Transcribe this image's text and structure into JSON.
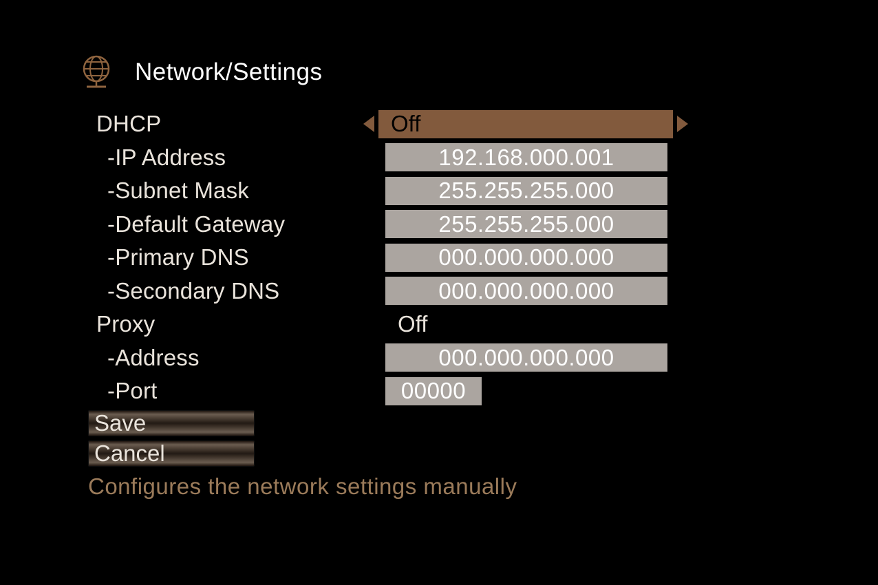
{
  "header": {
    "title": "Network/Settings",
    "icon_name": "globe-icon",
    "icon_color": "#8f643f"
  },
  "fields": {
    "dhcp": {
      "label": "DHCP",
      "value": "Off"
    },
    "ip_address": {
      "label": "-IP Address",
      "value": "192.168.000.001"
    },
    "subnet_mask": {
      "label": "-Subnet Mask",
      "value": "255.255.255.000"
    },
    "default_gateway": {
      "label": "-Default Gateway",
      "value": "255.255.255.000"
    },
    "primary_dns": {
      "label": "-Primary DNS",
      "value": "000.000.000.000"
    },
    "secondary_dns": {
      "label": "-Secondary DNS",
      "value": "000.000.000.000"
    },
    "proxy": {
      "label": "Proxy",
      "value": "Off"
    },
    "proxy_address": {
      "label": "-Address",
      "value": "000.000.000.000"
    },
    "proxy_port": {
      "label": "-Port",
      "value": "00000"
    }
  },
  "buttons": {
    "save": "Save",
    "cancel": "Cancel"
  },
  "hint": "Configures the network settings manually"
}
